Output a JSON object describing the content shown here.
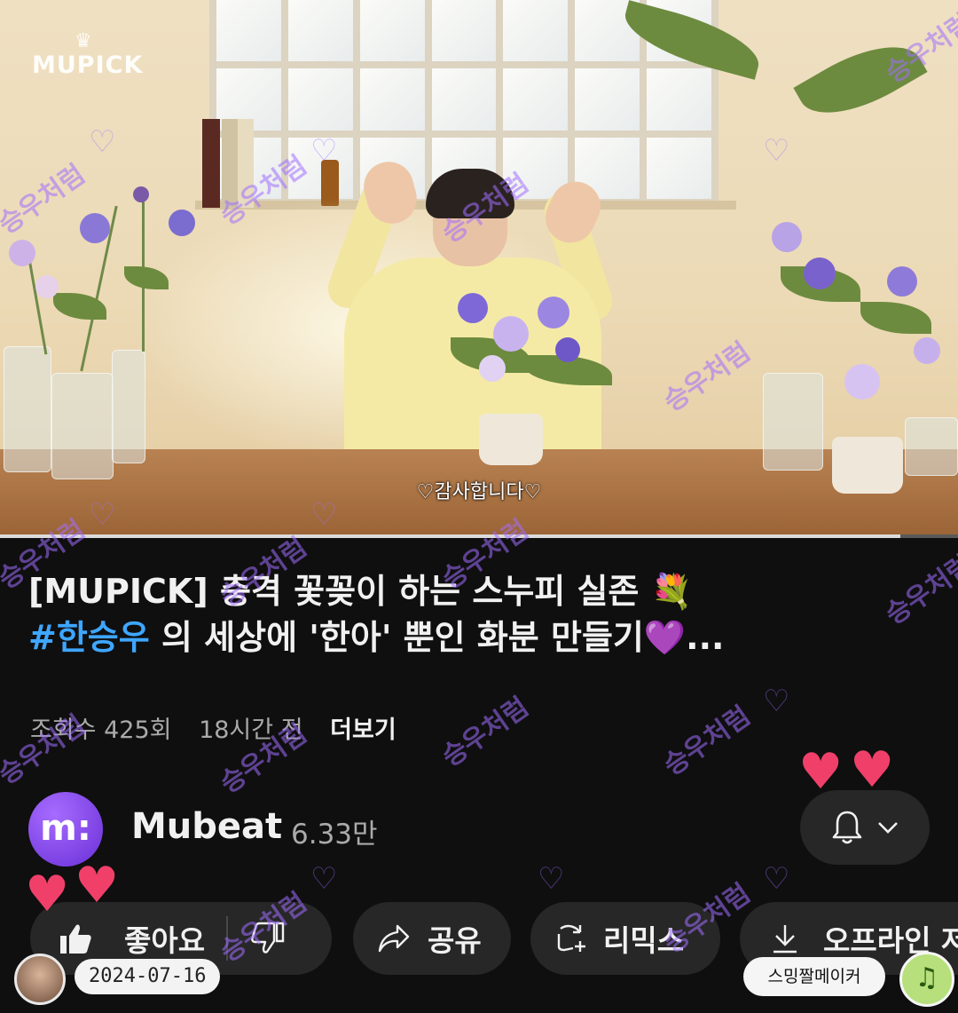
{
  "video": {
    "brand_logo": "MUPICK",
    "subtitle": "♡감사합니다♡",
    "progress_percent": 94
  },
  "title": {
    "line1": "[MUPICK] 충격 꽃꽂이 하는 스누피 실존 💐",
    "hashtag": "#한승우",
    "line2_rest": " 의 세상에 '한아' 뿐인 화분 만들기💜..."
  },
  "meta": {
    "views": "조회수 425회",
    "time_ago": "18시간 전",
    "more": "더보기"
  },
  "channel": {
    "avatar_letter": "m:",
    "name": "Mubeat",
    "subscribers": "6.33만"
  },
  "actions": {
    "like_label": "좋아요",
    "share_label": "공유",
    "remix_label": "리믹스",
    "download_label": "오프라인 저"
  },
  "overlay": {
    "date": "2024-07-16",
    "maker": "스밍짤메이커",
    "watermark_text": "승우처럼"
  },
  "colors": {
    "background": "#0f0f0f",
    "hashtag": "#3ea6ff",
    "heart": "#f0406a",
    "channel_avatar": "#8a4cf0"
  }
}
